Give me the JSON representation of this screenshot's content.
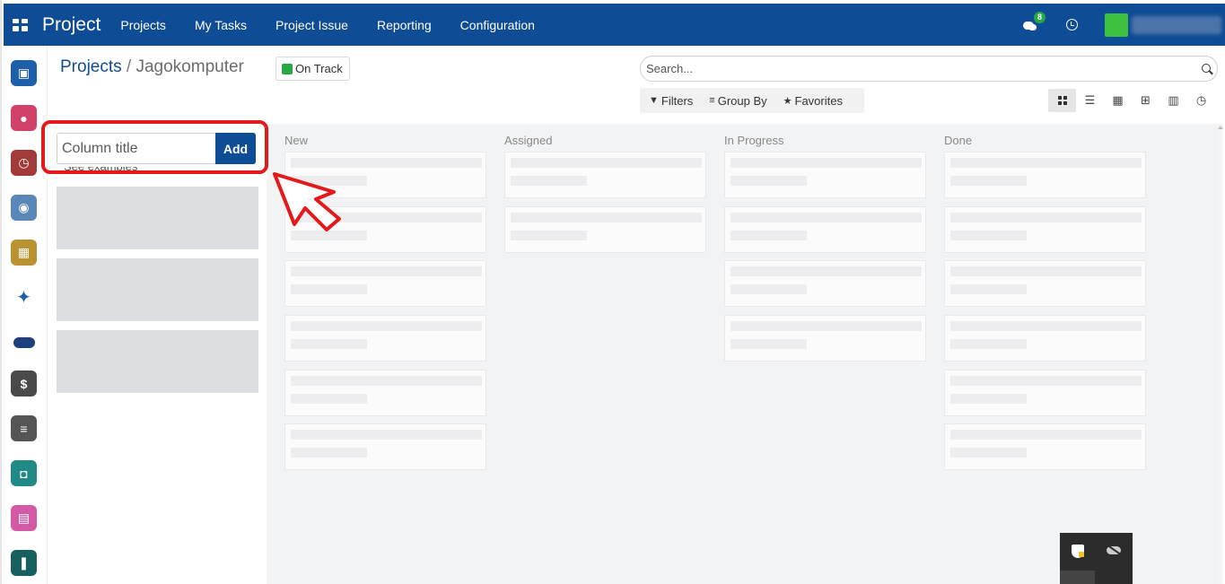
{
  "topbar": {
    "app_title": "Project",
    "nav": [
      "Projects",
      "My Tasks",
      "Project Issue",
      "Reporting",
      "Configuration"
    ],
    "chat_count": "8"
  },
  "breadcrumb": {
    "root": "Projects",
    "separator": "/",
    "current": "Jagokomputer"
  },
  "status": {
    "label": "On Track",
    "color": "#28a745"
  },
  "search": {
    "placeholder": "Search..."
  },
  "filters": {
    "filters_label": "Filters",
    "groupby_label": "Group By",
    "favorites_label": "Favorites"
  },
  "views": [
    "kanban-view",
    "list-view",
    "calendar-view",
    "pivot-view",
    "graph-view",
    "activity-view"
  ],
  "quick_create": {
    "placeholder": "Column title",
    "add_label": "Add",
    "examples_label": "See examples"
  },
  "stages": [
    {
      "title": "New",
      "cards": 6
    },
    {
      "title": "Assigned",
      "cards": 2
    },
    {
      "title": "In Progress",
      "cards": 4
    },
    {
      "title": "Done",
      "cards": 6
    }
  ],
  "dock_icons": [
    {
      "name": "dock-website-icon",
      "color": "#1d5fa8"
    },
    {
      "name": "dock-discuss-icon",
      "color": "#d1416a"
    },
    {
      "name": "dock-timer-icon",
      "color": "#a33a3a"
    },
    {
      "name": "dock-employees-icon",
      "color": "#5b87b8"
    },
    {
      "name": "dock-calendar-icon",
      "color": "#b8932f"
    },
    {
      "name": "dock-brand-icon",
      "color": "#ffffff"
    },
    {
      "name": "dock-badge-icon",
      "color": "#ffffff"
    },
    {
      "name": "dock-payroll-icon",
      "color": "#4a4a4a"
    },
    {
      "name": "dock-notes-icon",
      "color": "#555555"
    },
    {
      "name": "dock-contacts-icon",
      "color": "#1f8a86"
    },
    {
      "name": "dock-helpdesk-icon",
      "color": "#d45aa6"
    },
    {
      "name": "dock-project-icon",
      "color": "#16605f"
    }
  ],
  "colors": {
    "brand": "#0f4c96",
    "accent_red": "#e3191b"
  }
}
